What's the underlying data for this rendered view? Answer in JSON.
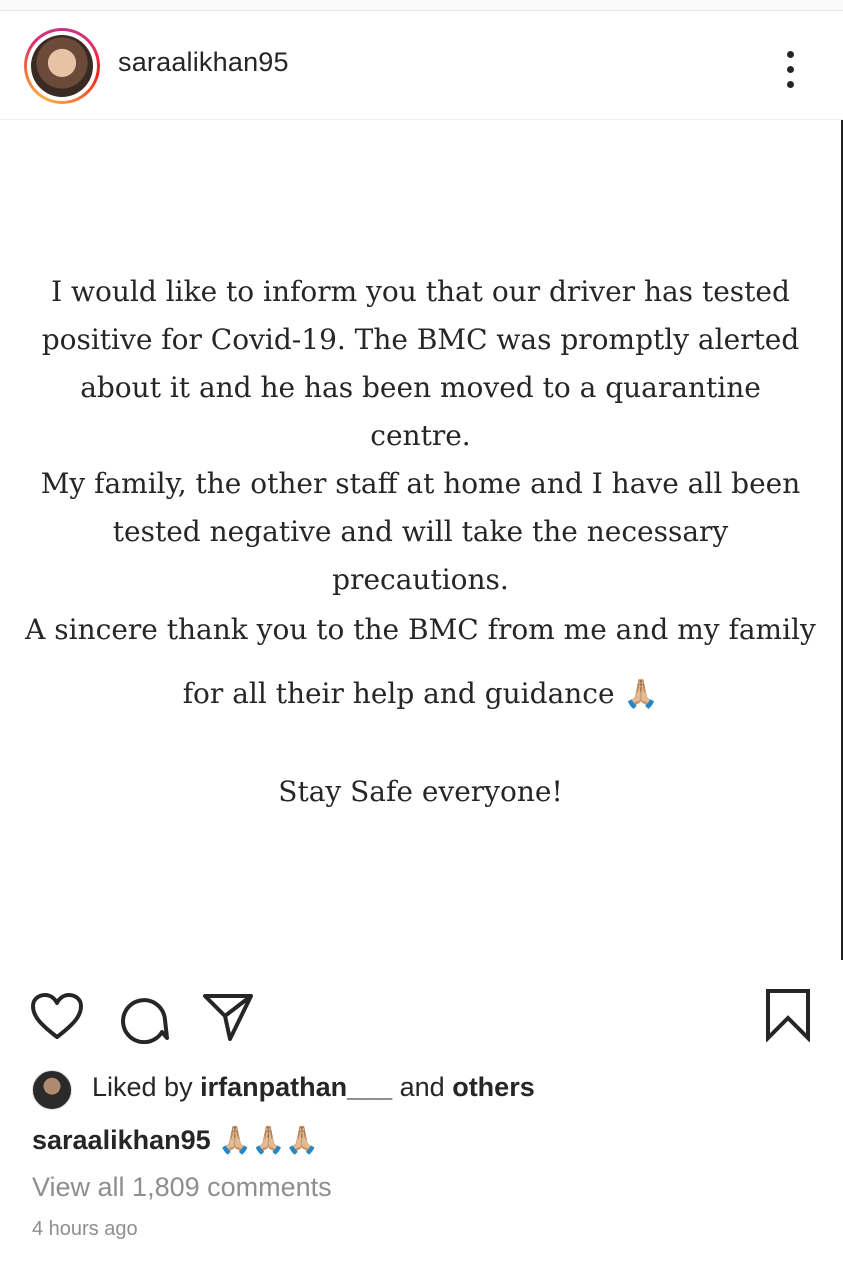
{
  "post": {
    "username": "saraalikhan95",
    "image_text": {
      "para1": "I would like to inform you that our driver has tested positive for Covid-19. The BMC was promptly alerted about it and he has been moved to a quarantine centre.",
      "para2": "My family, the other staff at home and I have all been tested negative and will take the necessary precautions.",
      "para3_line1": "A sincere thank you to the BMC from me and my family",
      "para3_line2": "for all their help and guidance 🙏🏼",
      "para4": "Stay Safe everyone!"
    },
    "likes": {
      "prefix": "Liked by ",
      "user": "irfanpathan___",
      "middle": " and ",
      "others": "others"
    },
    "caption": {
      "username": "saraalikhan95",
      "text": " 🙏🏼🙏🏼🙏🏼"
    },
    "view_comments": "View all 1,809 comments",
    "timestamp": "4 hours ago"
  },
  "icons": {
    "more": "more-vertical-icon",
    "like": "heart-icon",
    "comment": "comment-icon",
    "share": "send-icon",
    "save": "bookmark-icon"
  }
}
